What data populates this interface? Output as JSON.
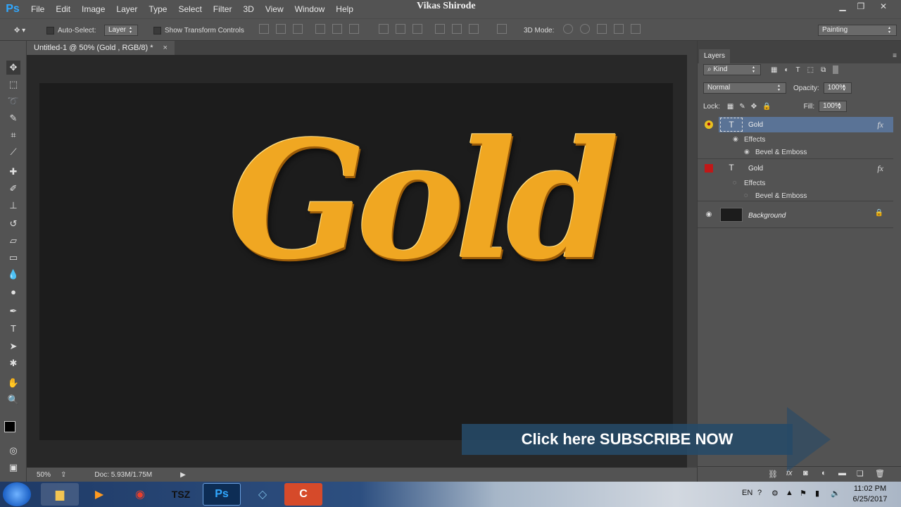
{
  "app": {
    "logo": "Ps",
    "watermark": "Vikas Shirode"
  },
  "menu": [
    "File",
    "Edit",
    "Image",
    "Layer",
    "Type",
    "Select",
    "Filter",
    "3D",
    "View",
    "Window",
    "Help"
  ],
  "window_controls": {
    "minimize": "▁",
    "restore": "❐",
    "close": "✕"
  },
  "options": {
    "auto_select_label": "Auto-Select:",
    "auto_select_value": "Layer",
    "show_transform_label": "Show Transform Controls",
    "mode_3d_label": "3D Mode:",
    "workspace": "Painting"
  },
  "document": {
    "tab_title": "Untitled-1 @ 50% (Gold , RGB/8) *",
    "close": "×",
    "art_text": "Gold"
  },
  "status": {
    "zoom": "50%",
    "doc_size": "Doc: 5.93M/1.75M"
  },
  "layers_panel": {
    "tab": "Layers",
    "filter_kind": "Kind",
    "blend_mode": "Normal",
    "opacity_label": "Opacity:",
    "opacity_value": "100%",
    "lock_label": "Lock:",
    "fill_label": "Fill:",
    "fill_value": "100%",
    "layers": [
      {
        "name": "Gold",
        "fx": "fx",
        "effects": "Effects",
        "effect": "Bevel & Emboss"
      },
      {
        "name": "Gold",
        "fx": "fx",
        "effects": "Effects",
        "effect": "Bevel & Emboss"
      },
      {
        "name": "Background"
      }
    ]
  },
  "overlay": {
    "subscribe": "Click here SUBSCRIBE NOW"
  },
  "taskbar": {
    "language": "EN",
    "time": "11:02 PM",
    "date": "6/25/2017",
    "apps": [
      "explorer",
      "media-player",
      "chrome",
      "tsz",
      "photoshop",
      "notepad",
      "camtasia"
    ]
  },
  "colors": {
    "accent_selected": "#5a7396",
    "gold": "#f0a722",
    "ps_blue": "#31a8ff"
  }
}
